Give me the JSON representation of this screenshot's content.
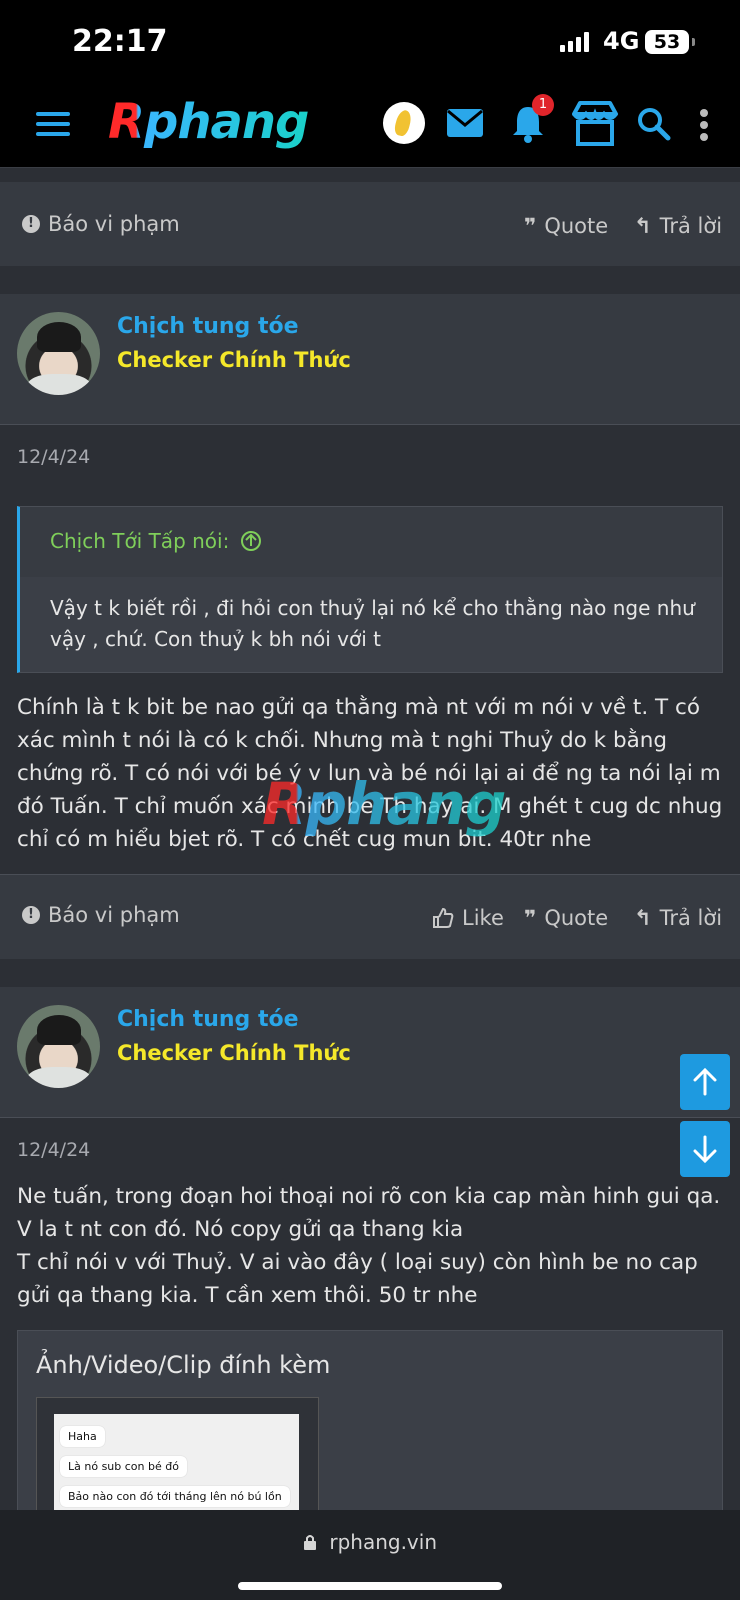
{
  "status": {
    "time": "22:17",
    "network": "4G",
    "battery": "53"
  },
  "header": {
    "logo_text": "Rphang",
    "notification_count": "1",
    "accent": "#2aa7ea"
  },
  "post_footer_1": {
    "report": "Báo vi phạm",
    "quote": "Quote",
    "reply": "Trả lời"
  },
  "post_2": {
    "username": "Chịch tung tóe",
    "user_title": "Checker Chính Thức",
    "date": "12/4/24",
    "quote_author": "Chịch Tới Tấp nói:",
    "quote_text": "Vậy t k biết rồi , đi hỏi con thuỷ lại nó kể cho thằng nào nge như vậy , chứ. Con thuỷ k bh nói với t",
    "body": "Chính là t k bit be nao gửi qa thằng mà nt với m nói v về t. T có xác mình t nói là có k chối. Nhưng mà t nghi Thuỷ do k bằng chứng rõ. T có nói với bé ý v lun và bé nói lại ai để ng ta nói lại m đó Tuấn. T chỉ muốn xác minh be Th hay ai. M ghét t cug dc nhug chỉ có m hiểu bjet rõ. T có chết cug mun bit. 40tr nhe",
    "report": "Báo vi phạm",
    "like": "Like",
    "quote": "Quote",
    "reply": "Trả lời"
  },
  "post_3": {
    "username": "Chịch tung tóe",
    "user_title": "Checker Chính Thức",
    "date": "12/4/24",
    "body_line1": "Ne tuấn, trong đoạn hoi thoại noi rõ con kia cap màn hinh gui qa. V la t nt con đó. Nó copy gửi qa thang kia",
    "body_line2": "T chỉ nói v với Thuỷ. V ai vào đây ( loại suy) còn hình be no cap gửi qa thang kia. T cần xem thôi. 50 tr nhe",
    "attachments_title": "Ảnh/Video/Clip đính kèm",
    "thumb_messages": [
      "Haha",
      "Là nó sub con bé đó",
      "Bảo nào con đó tới tháng lên nó bú lồn"
    ]
  },
  "watermark": "Rphang",
  "bottom": {
    "url": "rphang.vin"
  }
}
